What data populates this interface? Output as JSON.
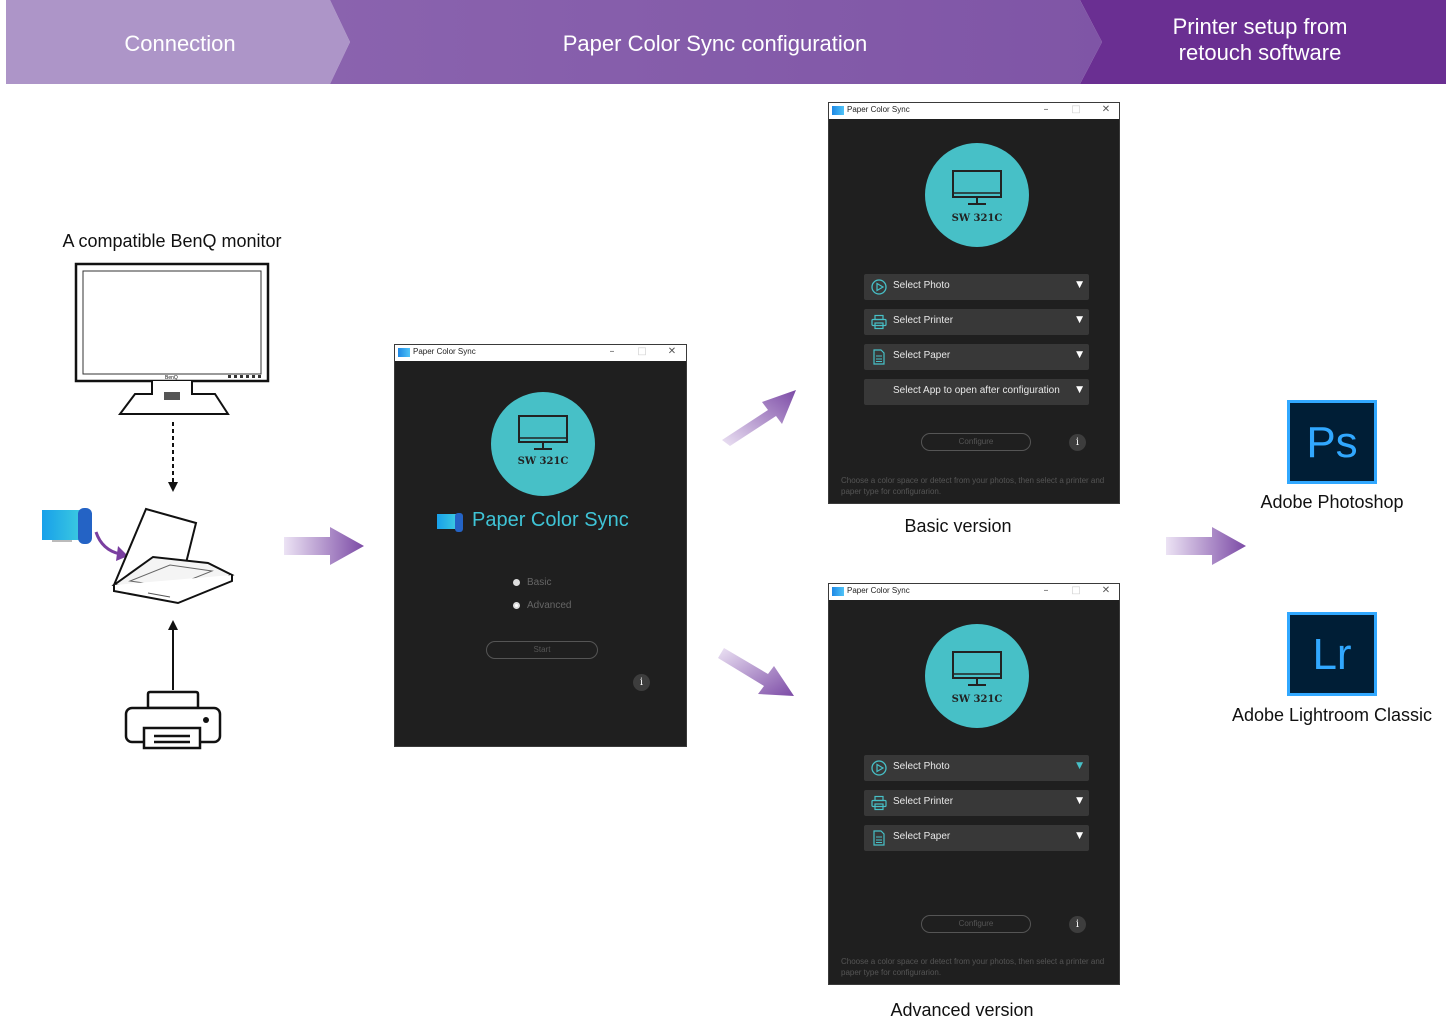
{
  "header": {
    "steps": [
      {
        "label": "Connection"
      },
      {
        "label": "Paper Color Sync configuration"
      },
      {
        "label_line1": "Printer setup from",
        "label_line2": "retouch software"
      }
    ],
    "colors": [
      "#ad95c8",
      "#8a63ae",
      "#6a2f92"
    ]
  },
  "connection": {
    "monitor_caption": "A compatible BenQ monitor",
    "monitor_brand": "BenQ"
  },
  "launcher": {
    "window_title": "Paper Color Sync",
    "model": "SW 321C",
    "app_name": "Paper Color Sync",
    "options": [
      "Basic",
      "Advanced"
    ],
    "selected_option": "Advanced",
    "start_label": "Start",
    "info_label": "i"
  },
  "basic": {
    "window_title": "Paper Color Sync",
    "model": "SW 321C",
    "dropdowns": [
      "Select Photo",
      "Select Printer",
      "Select Paper",
      "Select App to open after configuration"
    ],
    "configure_label": "Configure",
    "info_label": "i",
    "hint": "Choose a color space or detect from your photos, then select a printer and paper type for configurarion.",
    "caption": "Basic version"
  },
  "advanced": {
    "window_title": "Paper Color Sync",
    "model": "SW 321C",
    "dropdowns": [
      "Select Photo",
      "Select Printer",
      "Select Paper"
    ],
    "configure_label": "Configure",
    "info_label": "i",
    "hint": "Choose a color space or detect from your photos, then select a printer and paper type for configurarion.",
    "caption": "Advanced version"
  },
  "software": [
    {
      "icon_text": "Ps",
      "name": "Adobe Photoshop",
      "icon_color": "#31a8ff",
      "bg": "#001e36"
    },
    {
      "icon_text": "Lr",
      "name": "Adobe Lightroom Classic",
      "icon_color": "#31a8ff",
      "bg": "#001e36"
    }
  ],
  "accent_color": "#47c0c7"
}
